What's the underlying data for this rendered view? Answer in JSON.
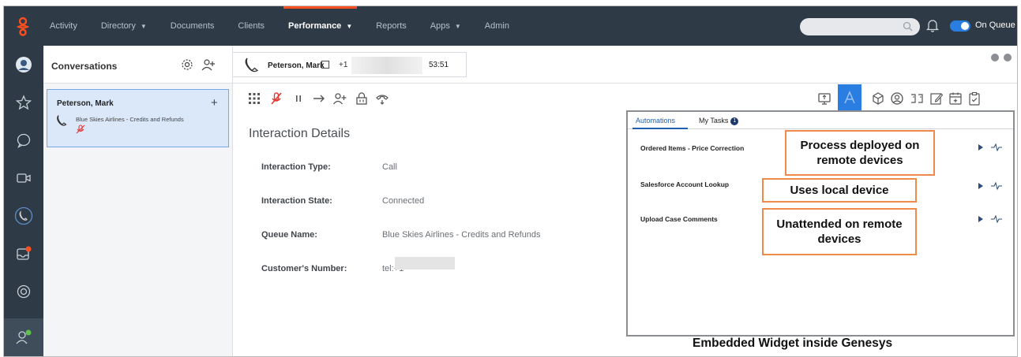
{
  "nav": {
    "items": [
      {
        "label": "Activity",
        "caret": false
      },
      {
        "label": "Directory",
        "caret": true
      },
      {
        "label": "Documents",
        "caret": false
      },
      {
        "label": "Clients",
        "caret": false
      },
      {
        "label": "Performance",
        "caret": true,
        "active": true
      },
      {
        "label": "Reports",
        "caret": false
      },
      {
        "label": "Apps",
        "caret": true
      },
      {
        "label": "Admin",
        "caret": false
      }
    ],
    "status_label": "On Queue",
    "accent": "#ff4f1f",
    "background": "#2e3a46"
  },
  "conversations": {
    "title": "Conversations",
    "card": {
      "name": "Peterson, Mark",
      "plus": "+",
      "description": "Blue Skies Airlines - Credits and Refunds"
    }
  },
  "call": {
    "name": "Peterson, Mark",
    "number_prefix": "+1",
    "timer": "53:51"
  },
  "details": {
    "title": "Interaction Details",
    "rows": [
      {
        "label": "Interaction Type:",
        "value": "Call"
      },
      {
        "label": "Interaction State:",
        "value": "Connected"
      },
      {
        "label": "Queue Name:",
        "value": "Blue Skies Airlines - Credits and Refunds"
      },
      {
        "label": "Customer's Number:",
        "value": "tel:+1"
      }
    ]
  },
  "widget": {
    "tabs": [
      "Automations",
      "My Tasks"
    ],
    "tasks_badge": "1",
    "automations": [
      "Ordered Items - Price Correction",
      "Salesforce Account Lookup",
      "Upload Case Comments"
    ],
    "callouts": [
      "Process deployed on remote devices",
      "Uses local device",
      "Unattended on remote devices"
    ],
    "caption": "Embedded Widget inside Genesys"
  }
}
